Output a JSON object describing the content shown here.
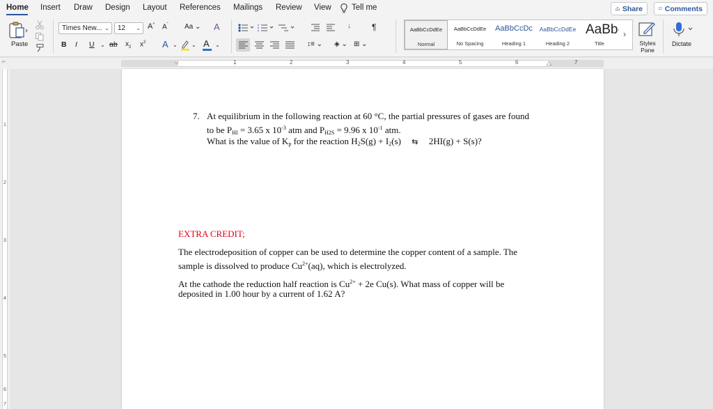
{
  "ribbon_tabs": [
    "Home",
    "Insert",
    "Draw",
    "Design",
    "Layout",
    "References",
    "Mailings",
    "Review",
    "View"
  ],
  "tell_me": "Tell me",
  "share_label": "Share",
  "comments_label": "Comments",
  "clipboard": {
    "paste_label": "Paste"
  },
  "font": {
    "name": "Times New...",
    "size": "12"
  },
  "styles": [
    {
      "sample": "AaBbCcDdEe",
      "name": "Normal"
    },
    {
      "sample": "AaBbCcDdEe",
      "name": "No Spacing"
    },
    {
      "sample": "AaBbCcDc",
      "name": "Heading 1"
    },
    {
      "sample": "AaBbCcDdEe",
      "name": "Heading 2"
    },
    {
      "sample": "AaBb(",
      "name": "Title"
    }
  ],
  "styles_pane_label": "Styles Pane",
  "dictate_label": "Dictate",
  "ruler_numbers": [
    "1",
    "2",
    "3",
    "4",
    "5",
    "6",
    "7"
  ],
  "vruler_numbers": [
    "1",
    "2",
    "3",
    "4",
    "5",
    "6",
    "7"
  ],
  "document": {
    "q7_number": "7.",
    "q7_line1": "At equilibrium in the following reaction at 60 °C, the partial pressures of gases are found",
    "q7_line2": {
      "a": "to be P",
      "sub1": "HI",
      "b": " = 3.65 x  10",
      "sup1": "-3",
      "c": " atm and P",
      "sub2": "H2S",
      "d": " = 9.96 x 10",
      "sup2": "-1",
      "e": " atm."
    },
    "q7_line3": {
      "a": "What is the value of K",
      "sub1": "p",
      "b": " for the reaction  H",
      "sub2": "2",
      "c": "S(g)  +  I",
      "sub3": "2",
      "d": "(s)",
      "arrow": "⇆",
      "e": "2HI(g)  +  S(s)?"
    },
    "extra_credit_label": "EXTRA CREDIT;",
    "ec_p1_line1": "The electrodeposition of copper can be used to determine the copper content of a sample.  The",
    "ec_p1_line2": {
      "a": "sample is dissolved to produce Cu",
      "sup": "2+",
      "b": "(aq), which is electrolyzed."
    },
    "ec_p2_line1": {
      "a": "At the cathode the reduction half reaction is Cu",
      "sup": "2+",
      "b": " + 2e    Cu(s).  What mass of copper will be"
    },
    "ec_p2_line2": "deposited in 1.00 hour by a current of 1.62 A?"
  }
}
